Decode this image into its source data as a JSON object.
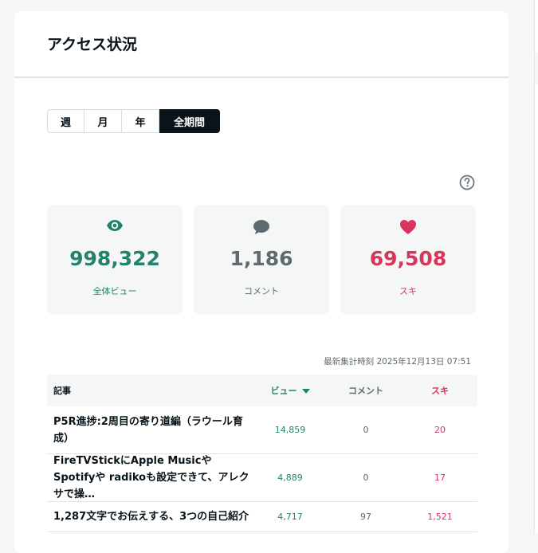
{
  "header": {
    "title": "アクセス状況"
  },
  "period_tabs": [
    {
      "label": "週",
      "active": false
    },
    {
      "label": "月",
      "active": false
    },
    {
      "label": "年",
      "active": false
    },
    {
      "label": "全期間",
      "active": true
    }
  ],
  "help": {
    "icon": "question-circle-icon"
  },
  "stats": {
    "views": {
      "icon": "eye-icon",
      "value": "998,322",
      "label": "全体ビュー",
      "color": "#23826d"
    },
    "comments": {
      "icon": "speech-bubble-icon",
      "value": "1,186",
      "label": "コメント",
      "color": "#5e6a70"
    },
    "likes": {
      "icon": "heart-icon",
      "value": "69,508",
      "label": "スキ",
      "color": "#d9345b"
    }
  },
  "updated_text": "最新集計時刻 2025年12月13日 07:51",
  "table": {
    "headers": {
      "title": "記事",
      "views": "ビュー",
      "comments": "コメント",
      "likes": "スキ"
    },
    "rows": [
      {
        "title": "P5R進捗:2周目の寄り道編（ラウール育成）",
        "views": "14,859",
        "comments": "0",
        "likes": "20"
      },
      {
        "title": "FireTVStickにApple MusicやSpotifyや radikoも設定できて、アレクサで操…",
        "views": "4,889",
        "comments": "0",
        "likes": "17"
      },
      {
        "title": "1,287文字でお伝えする、3つの自己紹介",
        "views": "4,717",
        "comments": "97",
        "likes": "1,521"
      }
    ]
  }
}
